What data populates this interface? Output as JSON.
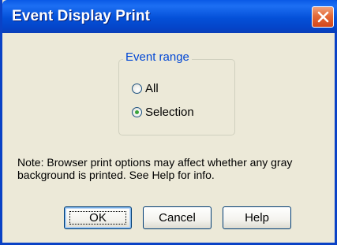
{
  "window": {
    "title": "Event Display Print"
  },
  "event_range": {
    "legend": "Event range",
    "options": [
      {
        "label": "All",
        "selected": false
      },
      {
        "label": "Selection",
        "selected": true
      }
    ]
  },
  "note": "Note:  Browser print options may affect whether any gray background is printed.  See Help for info.",
  "buttons": {
    "ok": "OK",
    "cancel": "Cancel",
    "help": "Help"
  },
  "colors": {
    "titlebar": "#0450d8",
    "window_bg": "#ece9d8",
    "legend_text": "#0046d5",
    "close_button": "#e46a38",
    "radio_dot": "#3aa33a"
  }
}
